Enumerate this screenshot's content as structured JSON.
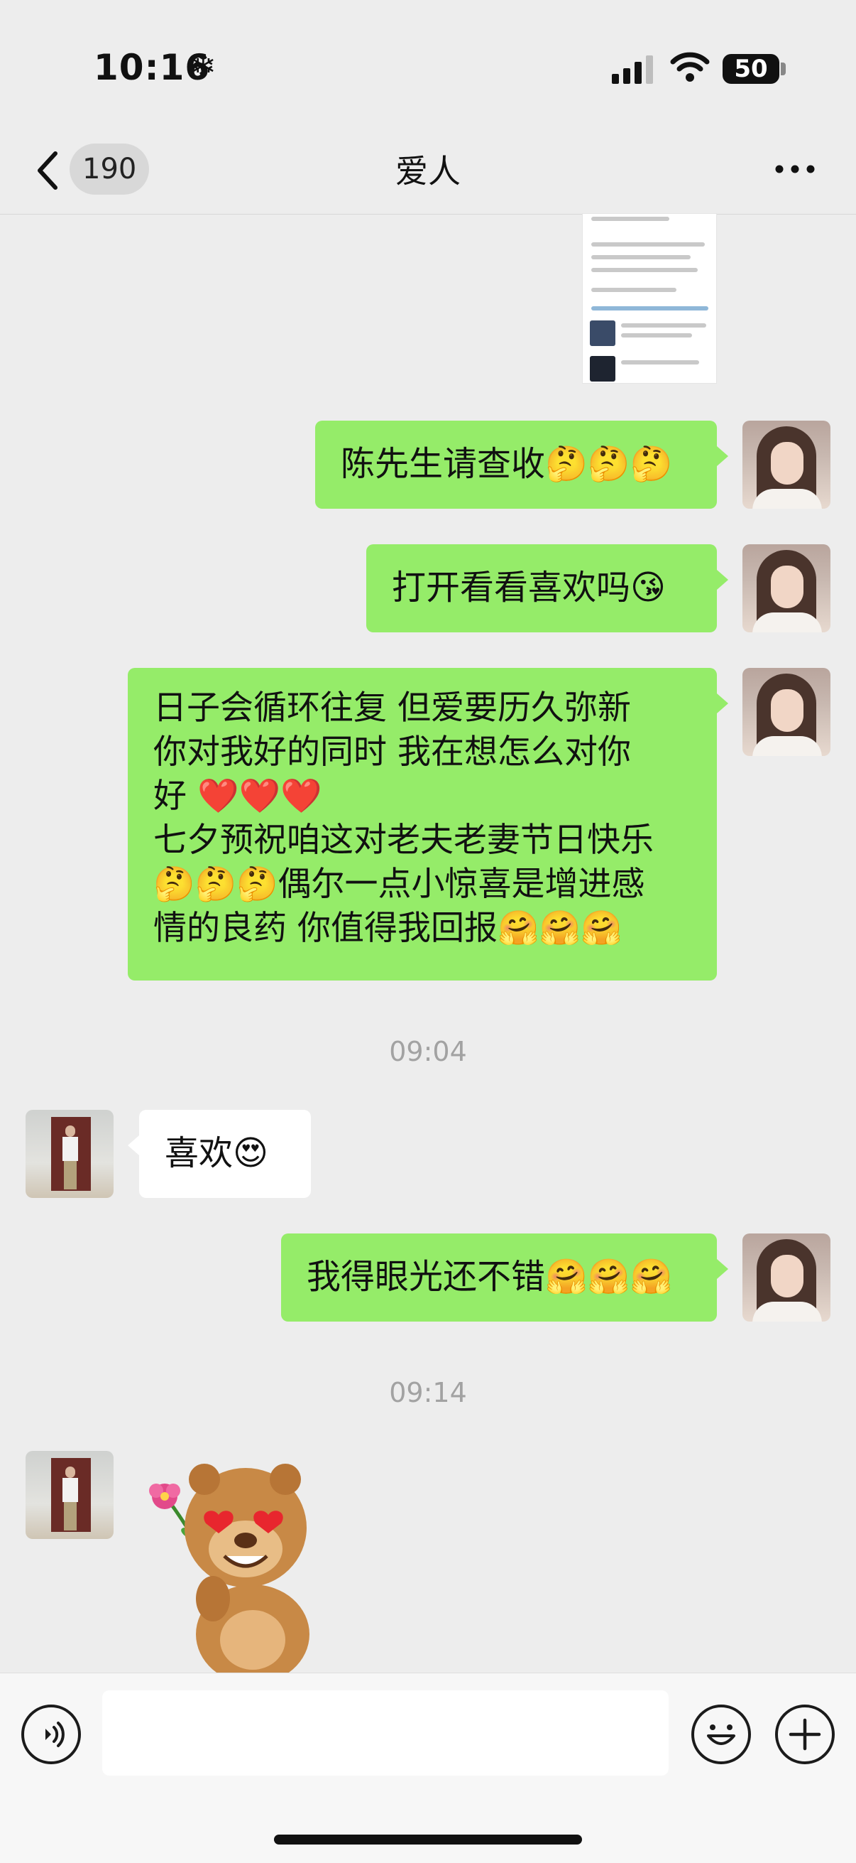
{
  "status_bar": {
    "time": "10:16",
    "weather_glyph": "❄",
    "battery": "50"
  },
  "nav": {
    "unread_count": "190",
    "title": "爱人"
  },
  "messages": [
    {
      "from": "me",
      "text": "陈先生请查收🤔🤔🤔"
    },
    {
      "from": "me",
      "text": "打开看看喜欢吗😘"
    },
    {
      "from": "me",
      "text": "日子会循环往复 但爱要历久弥新\n你对我好的同时 我在想怎么对你\n好 ❤️❤️❤️\n七夕预祝咱这对老夫老妻节日快乐\n🤔🤔🤔偶尔一点小惊喜是增进感\n情的良药 你值得我回报🤗🤗🤗"
    },
    {
      "timestamp": "09:04"
    },
    {
      "from": "them",
      "text": "喜欢😍"
    },
    {
      "from": "me",
      "text": "我得眼光还不错🤗🤗🤗"
    },
    {
      "timestamp": "09:14"
    },
    {
      "from": "them",
      "sticker": "bear-with-flower-sticker"
    }
  ],
  "input": {
    "placeholder": ""
  },
  "icons": {
    "back": "chevron-left-icon",
    "more": "ellipsis-icon",
    "voice": "voice-icon",
    "emoji": "emoji-icon",
    "plus": "plus-icon"
  },
  "colors": {
    "my_bubble": "#95ec69",
    "their_bubble": "#ffffff",
    "background": "#ededed"
  }
}
